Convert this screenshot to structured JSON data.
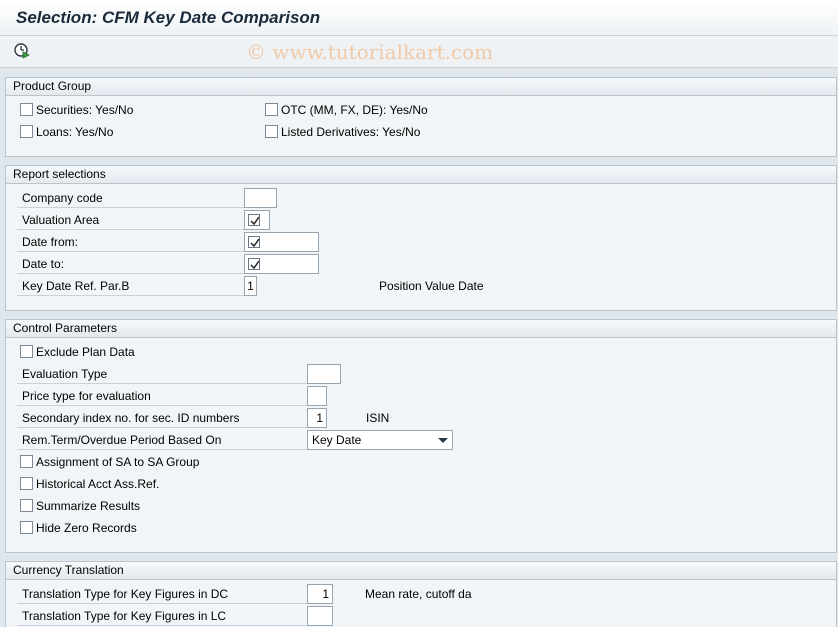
{
  "window": {
    "title": "Selection: CFM Key Date Comparison"
  },
  "toolbar": {
    "execute_icon": "clock-execute-icon",
    "watermark": "© www.tutorialkart.com"
  },
  "product_group": {
    "title": "Product Group",
    "securities": "Securities: Yes/No",
    "loans": "Loans: Yes/No",
    "otc": "OTC (MM, FX, DE): Yes/No",
    "listed_derivatives": "Listed Derivatives: Yes/No"
  },
  "report_selections": {
    "title": "Report selections",
    "company_code": {
      "label": "Company code",
      "value": ""
    },
    "valuation_area": {
      "label": "Valuation Area"
    },
    "date_from": {
      "label": "Date from:"
    },
    "date_to": {
      "label": "Date to:"
    },
    "key_date_ref": {
      "label": "Key Date Ref. Par.B",
      "value": "1",
      "desc": "Position Value Date"
    }
  },
  "control_parameters": {
    "title": "Control Parameters",
    "exclude_plan_data": "Exclude Plan Data",
    "evaluation_type": {
      "label": "Evaluation Type",
      "value": ""
    },
    "price_type": {
      "label": "Price type for evaluation",
      "value": ""
    },
    "secondary_index": {
      "label": "Secondary index no. for sec. ID numbers",
      "value": "1",
      "desc": "ISIN"
    },
    "rem_term": {
      "label": "Rem.Term/Overdue Period Based On",
      "selected": "Key Date"
    },
    "assignment_sa": "Assignment of SA to SA Group",
    "historical_acct": "Historical Acct Ass.Ref.",
    "summarize_results": "Summarize Results",
    "hide_zero_records": "Hide Zero Records"
  },
  "currency_translation": {
    "title": "Currency Translation",
    "translation_dc": {
      "label": "Translation Type for Key Figures in DC",
      "value": "1",
      "desc": "Mean rate, cutoff da"
    },
    "translation_lc": {
      "label": "Translation Type for Key Figures in LC",
      "value": ""
    }
  }
}
